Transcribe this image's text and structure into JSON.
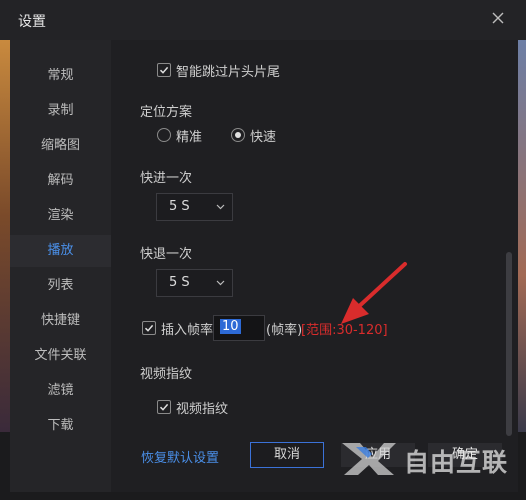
{
  "window": {
    "title": "设置"
  },
  "sidebar": {
    "items": [
      {
        "label": "常规"
      },
      {
        "label": "录制"
      },
      {
        "label": "缩略图"
      },
      {
        "label": "解码"
      },
      {
        "label": "渲染"
      },
      {
        "label": "播放"
      },
      {
        "label": "列表"
      },
      {
        "label": "快捷键"
      },
      {
        "label": "文件关联"
      },
      {
        "label": "滤镜"
      },
      {
        "label": "下载"
      }
    ],
    "active": "播放"
  },
  "content": {
    "skip_intro": {
      "label": "智能跳过片头片尾",
      "checked": true
    },
    "positioning": {
      "title": "定位方案",
      "options": [
        {
          "label": "精准",
          "selected": false
        },
        {
          "label": "快速",
          "selected": true
        }
      ]
    },
    "fast_forward": {
      "title": "快进一次",
      "value": "5 S"
    },
    "rewind": {
      "title": "快退一次",
      "value": "5 S"
    },
    "frame_interp": {
      "label": "插入帧率",
      "checked": true,
      "value": "10",
      "unit": "(帧率)",
      "range_note": "[范围:30-120]"
    },
    "fingerprint": {
      "title": "视频指纹",
      "checkbox": {
        "label": "视频指纹",
        "checked": true
      }
    }
  },
  "footer": {
    "restore_label": "恢复默认设置",
    "cancel_label": "取消",
    "apply_label": "应用",
    "ok_label": "确定"
  },
  "watermark": {
    "text": "自由互联"
  },
  "colors": {
    "accent": "#4a8fe8",
    "warning": "#d92c2c",
    "panel": "#1f1f22"
  }
}
